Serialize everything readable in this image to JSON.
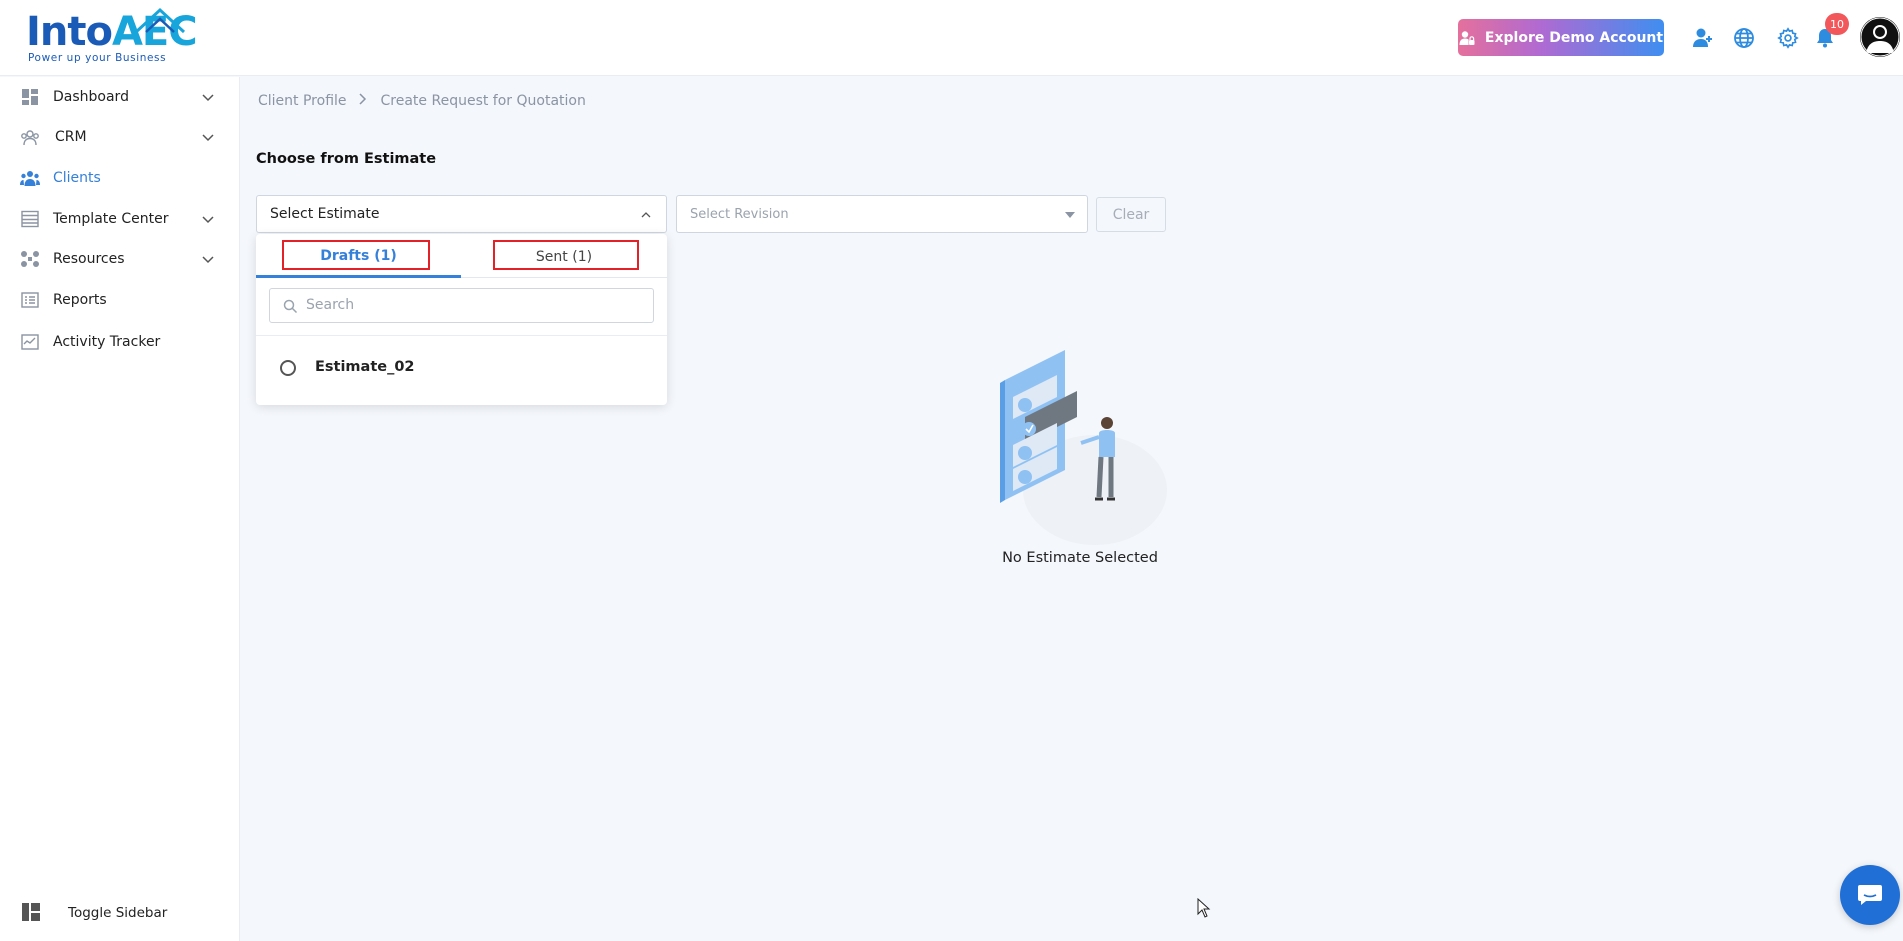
{
  "app": {
    "logo_main": "Into",
    "logo_accent": "AEC",
    "logo_tagline": "Power up your Business"
  },
  "header": {
    "demo_button_label": "Explore Demo Account",
    "notification_count": "10",
    "icons": [
      "add-user-icon",
      "globe-icon",
      "gear-icon",
      "bell-icon"
    ]
  },
  "sidebar": {
    "items": [
      {
        "label": "Dashboard",
        "icon": "dashboard-icon",
        "expandable": true
      },
      {
        "label": "CRM",
        "icon": "crm-icon",
        "expandable": true
      },
      {
        "label": "Clients",
        "icon": "clients-icon",
        "expandable": false,
        "active": true
      },
      {
        "label": "Template Center",
        "icon": "template-icon",
        "expandable": true
      },
      {
        "label": "Resources",
        "icon": "resources-icon",
        "expandable": true
      },
      {
        "label": "Reports",
        "icon": "reports-icon",
        "expandable": false
      },
      {
        "label": "Activity Tracker",
        "icon": "activity-icon",
        "expandable": false
      }
    ],
    "toggle_label": "Toggle Sidebar"
  },
  "breadcrumb": {
    "parent": "Client Profile",
    "current": "Create Request for Quotation"
  },
  "main": {
    "section_title": "Choose from Estimate",
    "select_estimate_label": "Select Estimate",
    "select_revision_placeholder": "Select Revision",
    "clear_label": "Clear",
    "empty_state_text": "No Estimate Selected"
  },
  "dropdown": {
    "tabs": [
      {
        "label": "Drafts (1)",
        "active": true
      },
      {
        "label": "Sent (1)",
        "active": false
      }
    ],
    "search_placeholder": "Search",
    "items": [
      {
        "label": "Estimate_02",
        "selected": false
      }
    ]
  },
  "colors": {
    "accent": "#3580d9",
    "highlight_box": "#e22228",
    "badge": "#f2585b"
  }
}
